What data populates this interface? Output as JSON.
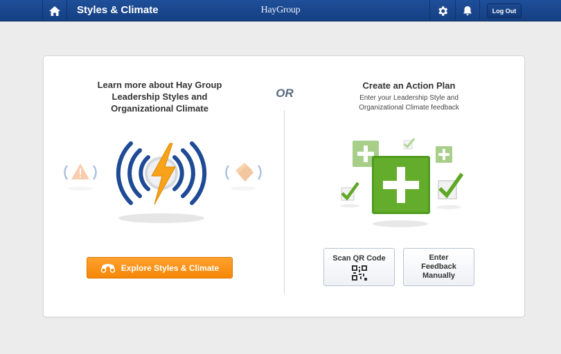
{
  "header": {
    "title": "Styles & Climate",
    "brand": "HayGroup",
    "logout_label": "Log Out"
  },
  "left_panel": {
    "title_line1": "Learn more about Hay Group",
    "title_line2": "Leadership Styles and",
    "title_line3": "Organizational Climate",
    "explore_button_label": "Explore Styles & Climate"
  },
  "divider_label": "OR",
  "right_panel": {
    "title": "Create an Action Plan",
    "subtitle_line1": "Enter your Leadership Style and",
    "subtitle_line2": "Organizational Climate feedback",
    "scan_button_label": "Scan QR Code",
    "manual_button_line1": "Enter",
    "manual_button_line2": "Feedback",
    "manual_button_line3": "Manually"
  },
  "icons": [
    "home-icon",
    "gear-icon",
    "bell-icon",
    "lightning-icon",
    "warning-icon",
    "tag-icon",
    "plus-icon",
    "checkmark-icon",
    "qr-code-icon",
    "binoculars-icon"
  ],
  "colors": {
    "header_blue": "#1a4890",
    "accent_orange": "#f7900f",
    "plus_green": "#5fa826",
    "wave_blue": "#1f4a96"
  }
}
